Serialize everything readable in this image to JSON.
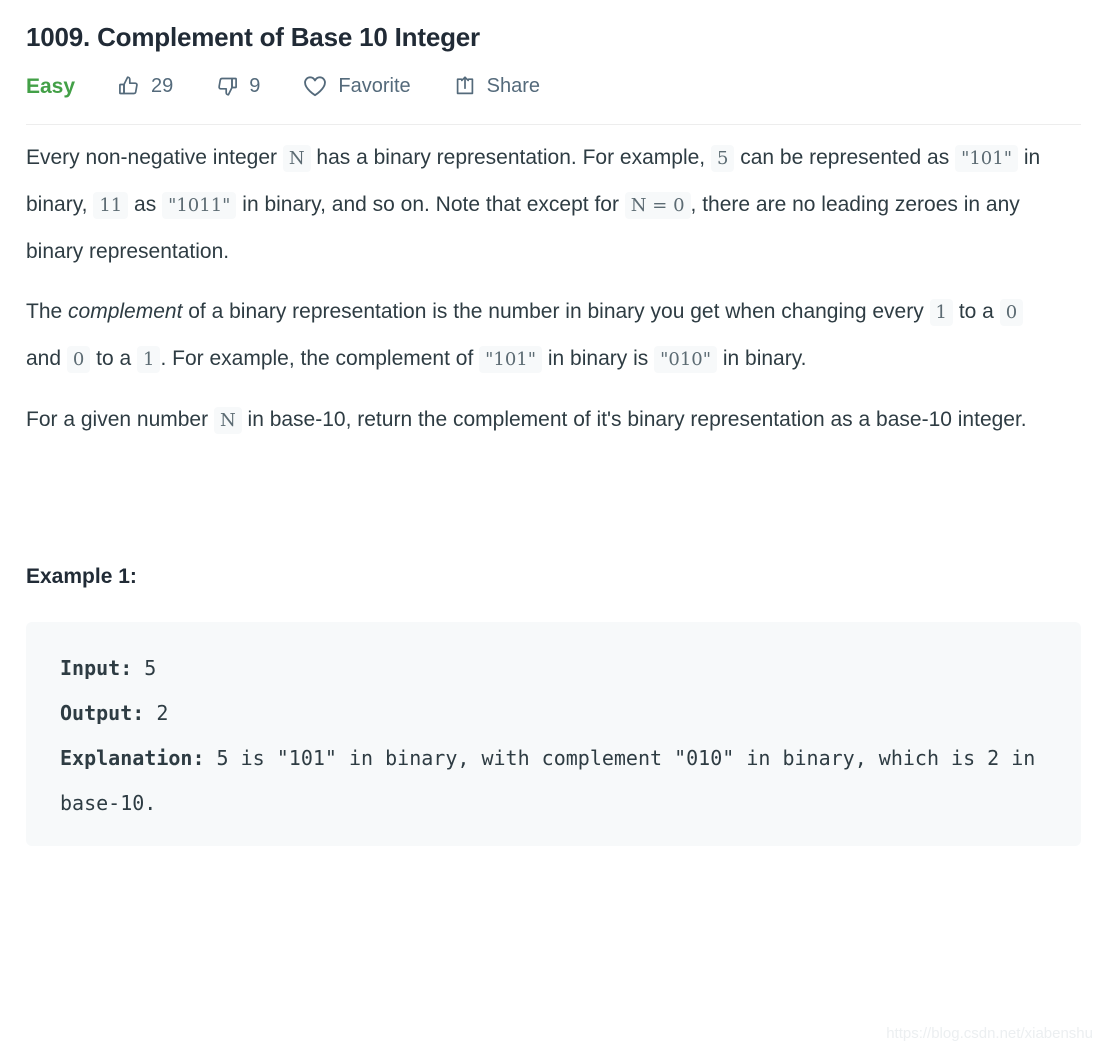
{
  "problem": {
    "title": "1009. Complement of Base 10 Integer",
    "difficulty": "Easy",
    "difficulty_color": "#43a047"
  },
  "toolbar": {
    "upvote_icon": "thumbs-up-icon",
    "upvote_count": "29",
    "downvote_icon": "thumbs-down-icon",
    "downvote_count": "9",
    "favorite_icon": "heart-icon",
    "favorite_label": "Favorite",
    "share_icon": "share-icon",
    "share_label": "Share",
    "icon_color": "#546a7b"
  },
  "description": {
    "paragraphs": [
      [
        {
          "t": "text",
          "v": "Every non-negative integer "
        },
        {
          "t": "code",
          "v": "N"
        },
        {
          "t": "text",
          "v": " has a binary representation.  For example, "
        },
        {
          "t": "code",
          "v": "5"
        },
        {
          "t": "text",
          "v": " can be represented as "
        },
        {
          "t": "code",
          "v": "\"101\""
        },
        {
          "t": "text",
          "v": " in binary, "
        },
        {
          "t": "code",
          "v": "11"
        },
        {
          "t": "text",
          "v": " as "
        },
        {
          "t": "code",
          "v": "\"1011\""
        },
        {
          "t": "text",
          "v": " in binary, and so on.  Note that except for "
        },
        {
          "t": "code",
          "v": "N = 0"
        },
        {
          "t": "text",
          "v": ", there are no leading zeroes in any binary representation."
        }
      ],
      [
        {
          "t": "text",
          "v": "The "
        },
        {
          "t": "em",
          "v": "complement"
        },
        {
          "t": "text",
          "v": " of a binary representation is the number in binary you get when changing every "
        },
        {
          "t": "code",
          "v": "1"
        },
        {
          "t": "text",
          "v": " to a "
        },
        {
          "t": "code",
          "v": "0"
        },
        {
          "t": "text",
          "v": " and "
        },
        {
          "t": "code",
          "v": "0"
        },
        {
          "t": "text",
          "v": " to a "
        },
        {
          "t": "code",
          "v": "1"
        },
        {
          "t": "text",
          "v": ".  For example, the complement of "
        },
        {
          "t": "code",
          "v": "\"101\""
        },
        {
          "t": "text",
          "v": " in binary is "
        },
        {
          "t": "code",
          "v": "\"010\""
        },
        {
          "t": "text",
          "v": " in binary."
        }
      ],
      [
        {
          "t": "text",
          "v": "For a given number "
        },
        {
          "t": "code",
          "v": "N"
        },
        {
          "t": "text",
          "v": " in base-10, return the complement of it's binary representation as a base-10 integer."
        }
      ]
    ]
  },
  "example": {
    "heading": "Example 1:",
    "lines": [
      [
        {
          "t": "b",
          "v": "Input:"
        },
        {
          "t": "text",
          "v": " 5"
        }
      ],
      [
        {
          "t": "b",
          "v": "Output:"
        },
        {
          "t": "text",
          "v": " 2"
        }
      ],
      [
        {
          "t": "b",
          "v": "Explanation:"
        },
        {
          "t": "text",
          "v": " 5 is \"101\" in binary, with complement \"010\" in binary, which is 2 in base-10."
        }
      ]
    ]
  },
  "watermark": {
    "text": "https://blog.csdn.net/xiabenshu"
  }
}
